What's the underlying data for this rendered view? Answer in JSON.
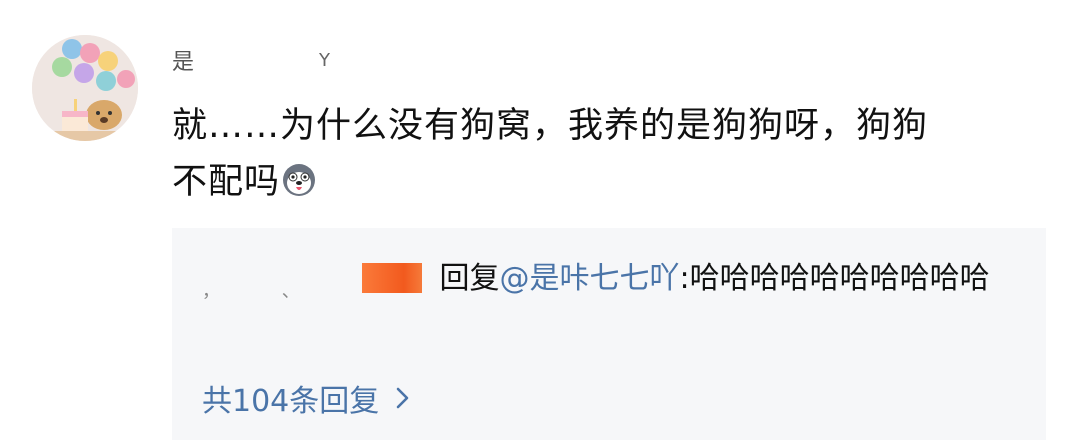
{
  "comment": {
    "username_start": "是",
    "username_end": "Y",
    "text_line1": "就……为什么没有狗窝，我养的是狗狗呀，狗狗",
    "text_line2": "不配吗",
    "emoji_icon": "husky-emoji-icon"
  },
  "reply": {
    "user_fragments": "，  、",
    "action": "回复",
    "mention": "@是咔七七吖",
    "text": ":哈哈哈哈哈哈哈哈哈哈",
    "more_label": "共104条回复"
  },
  "colors": {
    "link": "#4a74a8",
    "reply_bg": "#f6f7f9",
    "highlight": "#f25a1e"
  }
}
